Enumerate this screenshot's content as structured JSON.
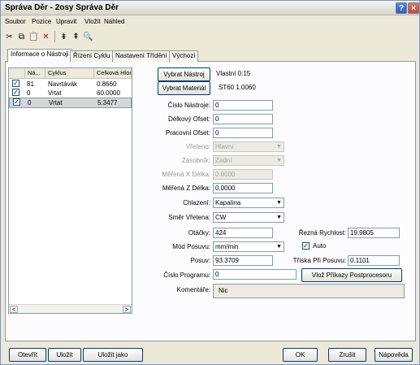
{
  "window": {
    "title": "Správa Děr - 2osy Správa Děr"
  },
  "title_buttons": {
    "help": "?",
    "close": "×"
  },
  "menu": [
    "Soubor",
    "Pozice",
    "Upravit",
    "Vložit",
    "Náhled"
  ],
  "toolbar": {
    "icons": [
      "cut-icon",
      "copy-icon",
      "paste-icon",
      "delete-icon",
      "insert-before-icon",
      "insert-after-icon",
      "preview-icon"
    ],
    "glyphs": [
      "✂",
      "⧉",
      "📋",
      "✕",
      "⇟",
      "⇞",
      "🔍"
    ]
  },
  "tabs": [
    "Informace o Nástroji",
    "Řízení Cyklu",
    "Nastavení Třídění",
    "Výchozí"
  ],
  "list": {
    "columns": [
      "Ná...",
      "Cyklus",
      "Celková Hlou"
    ],
    "rows": [
      {
        "checked": "✓",
        "num": "81",
        "cycle": "Navrtávák",
        "depth": "0.8660"
      },
      {
        "checked": "✓",
        "num": "0",
        "cycle": "Vrtat",
        "depth": "60.0000"
      },
      {
        "checked": "✓",
        "num": "0",
        "cycle": "Vrtat",
        "depth": "5.3477"
      }
    ],
    "scroll_left": "<",
    "scroll_right": ">"
  },
  "tool": {
    "select_tool_button": "Vybrat Nástroj",
    "select_material_button": "Vybrat Materiál",
    "tool_name": "Vlastní 0:15",
    "material_name": "ST60 1.0060"
  },
  "form": {
    "tool_number": {
      "label": "Číslo Nástroje:",
      "value": "0"
    },
    "length_offset": {
      "label": "Délkový Ofset:",
      "value": "0"
    },
    "work_offset": {
      "label": "Pracovní Ofset:",
      "value": "0"
    },
    "spindle": {
      "label": "Vřeteno:",
      "value": "Hlavní"
    },
    "magazine": {
      "label": "Zásobník:",
      "value": "Zadní"
    },
    "measured_x": {
      "label": "Měřená X Délka:",
      "value": "0.0000"
    },
    "measured_z": {
      "label": "Měřená Z Délka:",
      "value": "0.0000"
    },
    "coolant": {
      "label": "Chlazení:",
      "value": "Kapalina"
    },
    "spindle_direction": {
      "label": "Směr Vřetena:",
      "value": "CW"
    },
    "rpm": {
      "label": "Otáčky:",
      "value": "424"
    },
    "cutting_speed": {
      "label": "Řezná Rychlost:",
      "value": "19.9805"
    },
    "feed_mode": {
      "label": "Mód Posuvu:",
      "value": "mm/min"
    },
    "auto": {
      "label": "Auto",
      "checked": "✓"
    },
    "feed": {
      "label": "Posuv:",
      "value": "93.3709"
    },
    "chip_per_feed": {
      "label": "Tříska Při Posuvu:",
      "value": "0.1101"
    },
    "program_number": {
      "label": "Číslo Programu:",
      "value": "0"
    },
    "postprocessor_button": "Vlož Příkazy Postprocesoru",
    "comment": {
      "label": "Komentáře:",
      "value": "Nic"
    }
  },
  "footer": {
    "open": "Otevřít",
    "save": "Uložit",
    "save_as": "Uložit jako",
    "ok": "OK",
    "cancel": "Zrušit",
    "help": "Nápověda"
  },
  "dropdown_glyph": "▼"
}
